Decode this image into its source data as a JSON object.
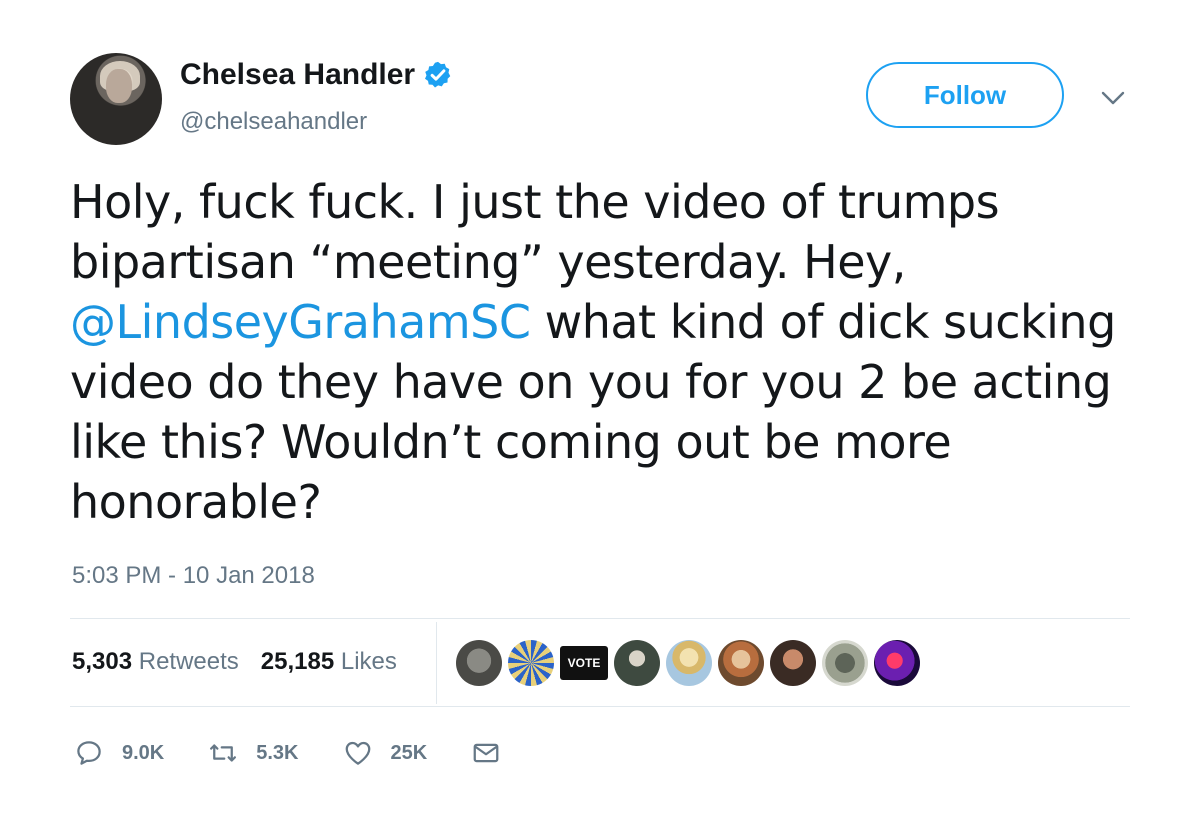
{
  "author": {
    "display_name": "Chelsea Handler",
    "handle": "@chelseahandler",
    "verified_icon": "verified-badge-icon"
  },
  "header": {
    "follow_label": "Follow",
    "more_icon": "chevron-down-icon"
  },
  "tweet": {
    "text_before": "Holy, fuck fuck. I just the video of trumps bipartisan “meeting” yesterday. Hey, ",
    "mention": "@LindseyGrahamSC",
    "text_after": " what kind of dick sucking video do they have on you for you 2 be acting like this? Wouldn’t coming out be more honorable?",
    "timestamp": "5:03 PM - 10 Jan 2018"
  },
  "stats": {
    "retweets_count": "5,303",
    "retweets_label": "Retweets",
    "likes_count": "25,185",
    "likes_label": "Likes",
    "vote_badge_text": "VOTE"
  },
  "actions": {
    "reply_count": "9.0K",
    "retweet_count": "5.3K",
    "like_count": "25K"
  },
  "colors": {
    "accent": "#1da1f2",
    "mention": "#1b95e0",
    "secondary_text": "#657786",
    "divider": "#e1e8ed"
  }
}
